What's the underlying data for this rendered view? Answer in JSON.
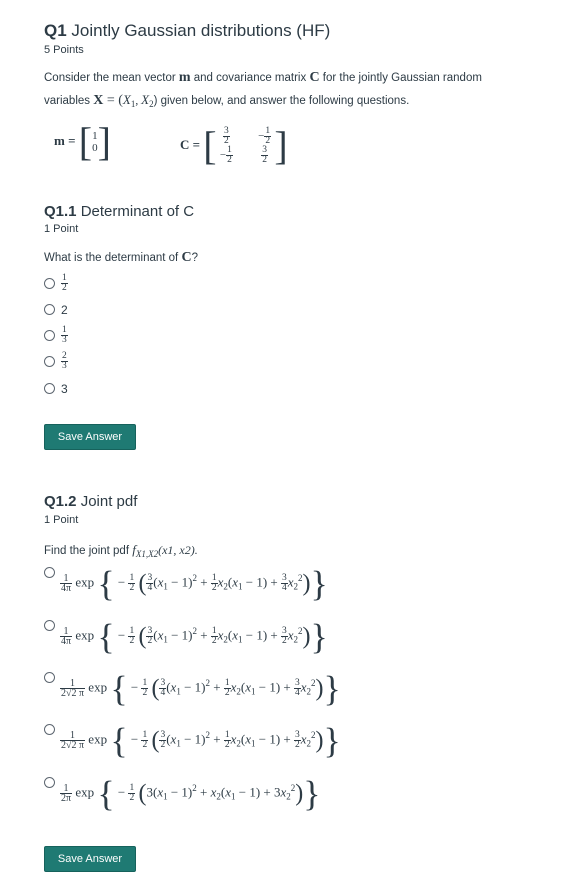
{
  "q1": {
    "number": "Q1",
    "title": "Jointly Gaussian distributions (HF)",
    "points": "5 Points",
    "intro_a": "Consider the mean vector ",
    "m": "m",
    "intro_b": " and covariance matrix ",
    "C": "C",
    "intro_c": " for the jointly Gaussian random",
    "intro_d": "variables ",
    "X": "X",
    "X_eq": " = (",
    "X1": "X",
    "X1_sub": "1",
    "X2": "X",
    "X2_sub": "2",
    "intro_e": ") given below, and answer the following questions.",
    "m_eq": "m =",
    "m_vec": [
      "1",
      "0"
    ],
    "C_eq": "C =",
    "C_mat": {
      "r1c1": {
        "num": "3",
        "den": "2"
      },
      "r1c2": {
        "sign": "−",
        "num": "1",
        "den": "2"
      },
      "r2c1": {
        "sign": "−",
        "num": "1",
        "den": "2"
      },
      "r2c2": {
        "num": "3",
        "den": "2"
      }
    }
  },
  "q11": {
    "number": "Q1.1",
    "title": "Determinant of C",
    "points": "1 Point",
    "prompt": "What is the determinant of ",
    "C": "C",
    "prompt_end": "?",
    "options": [
      {
        "type": "frac",
        "num": "1",
        "den": "2"
      },
      {
        "type": "text",
        "text": "2"
      },
      {
        "type": "frac",
        "num": "1",
        "den": "3"
      },
      {
        "type": "frac",
        "num": "2",
        "den": "3"
      },
      {
        "type": "text",
        "text": "3"
      }
    ],
    "save": "Save Answer"
  },
  "q12": {
    "number": "Q1.2",
    "title": "Joint pdf",
    "points": "1 Point",
    "prompt": "Find the joint pdf ",
    "f": "f",
    "f_sub": "X1,X2",
    "f_args": "(x1, x2).",
    "exp": "exp",
    "options": [
      {
        "coef_num": "1",
        "coef_den": "4π",
        "a": "3",
        "b": "4",
        "c": "1",
        "d": "2",
        "e": "3",
        "g": "4"
      },
      {
        "coef_num": "1",
        "coef_den": "4π",
        "a": "3",
        "b": "2",
        "c": "1",
        "d": "2",
        "e": "3",
        "g": "2"
      },
      {
        "coef_num": "1",
        "coef_den": "2√2 π",
        "a": "3",
        "b": "4",
        "c": "1",
        "d": "2",
        "e": "3",
        "g": "4"
      },
      {
        "coef_num": "1",
        "coef_den": "2√2 π",
        "a": "3",
        "b": "2",
        "c": "1",
        "d": "2",
        "e": "3",
        "g": "2"
      },
      {
        "coef_num": "1",
        "coef_den": "2π",
        "plain": "(3(x₁ − 1)² + x₂(x₁ − 1) + 3x₂²)"
      }
    ],
    "save": "Save Answer"
  }
}
